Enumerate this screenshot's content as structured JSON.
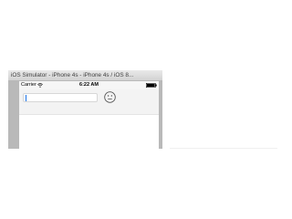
{
  "window": {
    "title": "iOS Simulator - iPhone 4s - iPhone 4s / iOS 8..."
  },
  "status_bar": {
    "carrier": "Carrier",
    "time": "6:22 AM",
    "wifi_icon": "wifi-icon",
    "battery_icon": "battery-icon"
  },
  "text_field": {
    "value": "",
    "placeholder": ""
  },
  "button": {
    "icon": "smiley-icon"
  },
  "colors": {
    "caret": "#1a73e8",
    "content_bg": "#f3f3f3",
    "window_frame": "#b9b9b9"
  }
}
